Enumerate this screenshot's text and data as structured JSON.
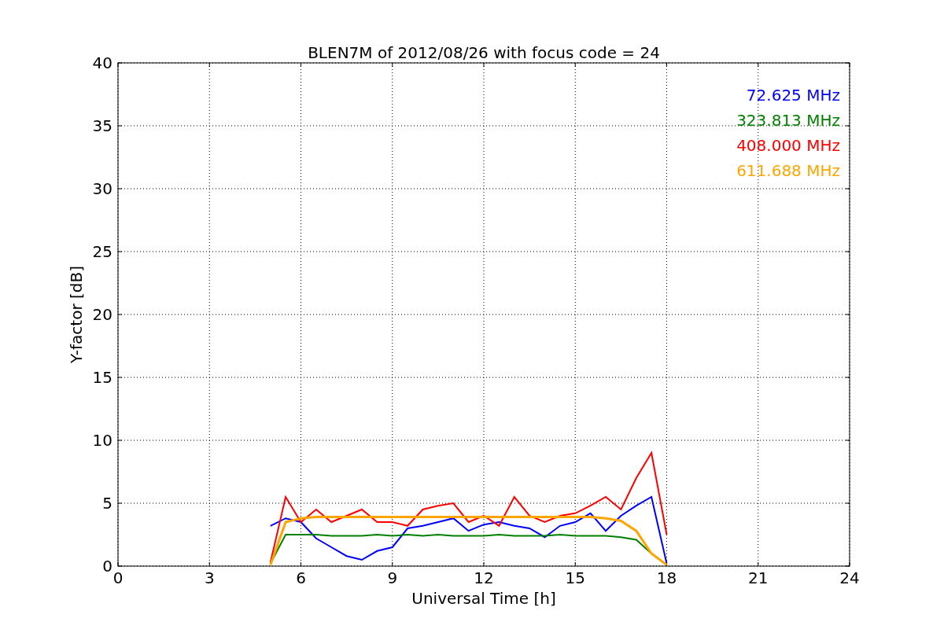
{
  "figure": {
    "chart_data": {
      "type": "line",
      "title": "BLEN7M of 2012/08/26 with focus code = 24",
      "xlabel": "Universal Time [h]",
      "ylabel": "Y-factor [dB]",
      "x": [
        5,
        5.5,
        6,
        6.5,
        7,
        7.5,
        8,
        8.5,
        9,
        9.5,
        10,
        10.5,
        11,
        11.5,
        12,
        12.5,
        13,
        13.5,
        14,
        14.5,
        15,
        15.5,
        16,
        16.5,
        17,
        17.5,
        18
      ],
      "series": [
        {
          "name": "72.625 MHz",
          "color": "#0000ff",
          "values": [
            3.2,
            3.8,
            3.5,
            2.2,
            1.5,
            0.8,
            0.5,
            1.2,
            1.5,
            3.0,
            3.2,
            3.5,
            3.8,
            2.8,
            3.3,
            3.5,
            3.2,
            3.0,
            2.3,
            3.2,
            3.5,
            4.2,
            2.8,
            4.0,
            4.8,
            5.5,
            0.2
          ]
        },
        {
          "name": "323.813 MHz",
          "color": "#008000",
          "values": [
            0.2,
            2.5,
            2.5,
            2.5,
            2.4,
            2.4,
            2.4,
            2.5,
            2.4,
            2.5,
            2.4,
            2.5,
            2.4,
            2.4,
            2.4,
            2.5,
            2.4,
            2.4,
            2.4,
            2.5,
            2.4,
            2.4,
            2.4,
            2.3,
            2.1,
            1.0,
            0.1
          ]
        },
        {
          "name": "408.000 MHz",
          "color": "#ff0000",
          "values": [
            0.3,
            5.5,
            3.5,
            4.5,
            3.5,
            4.0,
            4.5,
            3.5,
            3.5,
            3.2,
            4.5,
            4.8,
            5.0,
            3.5,
            4.0,
            3.2,
            5.5,
            4.0,
            3.5,
            4.0,
            4.2,
            4.8,
            5.5,
            4.5,
            7.0,
            9.0,
            2.5
          ]
        },
        {
          "name": "611.688 MHz",
          "color": "#ffa500",
          "values": [
            0.1,
            3.5,
            3.8,
            3.9,
            3.9,
            3.9,
            3.9,
            3.9,
            3.9,
            3.9,
            3.9,
            3.9,
            3.9,
            3.9,
            3.9,
            3.9,
            3.9,
            3.9,
            3.9,
            3.9,
            3.9,
            3.9,
            3.8,
            3.6,
            2.8,
            1.0,
            0.1
          ]
        }
      ],
      "xlim": [
        0,
        24
      ],
      "ylim": [
        0,
        40
      ],
      "grid": true,
      "xticks": [
        0,
        3,
        6,
        9,
        12,
        15,
        18,
        21,
        24
      ],
      "yticks": [
        0,
        5,
        10,
        15,
        20,
        25,
        30,
        35,
        40
      ]
    }
  }
}
